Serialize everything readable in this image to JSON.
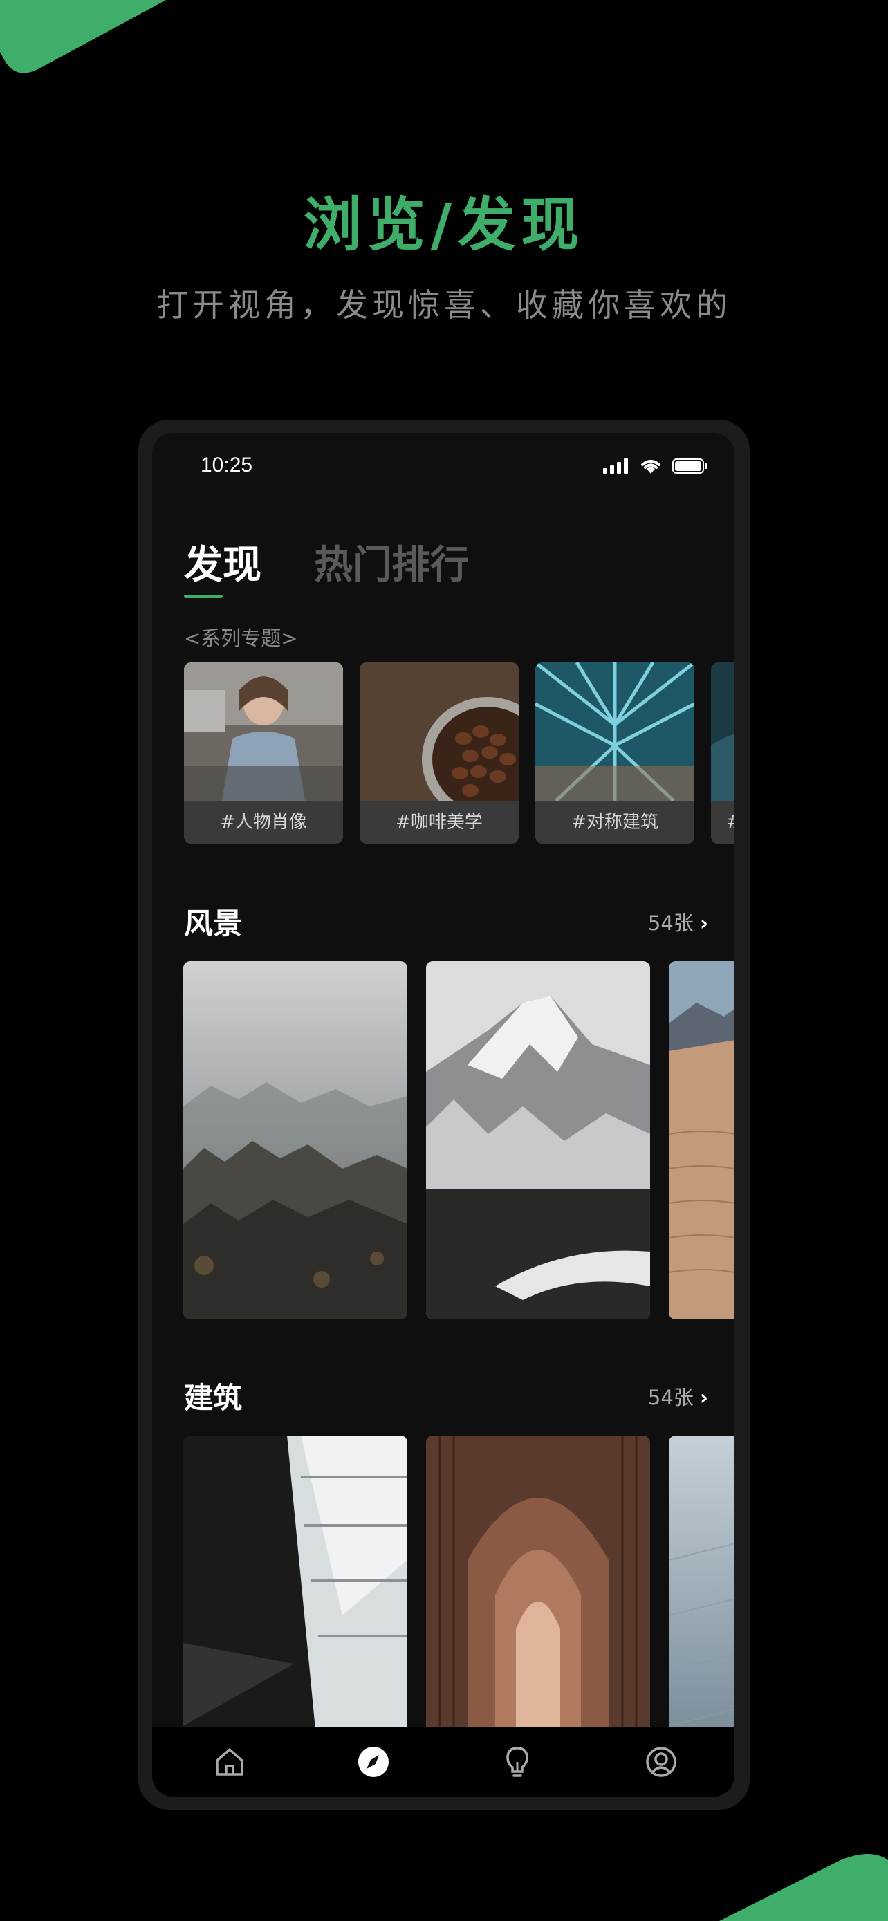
{
  "hero": {
    "title": "浏览/发现",
    "subtitle": "打开视角，发现惊喜、收藏你喜欢的"
  },
  "status_bar": {
    "time": "10:25"
  },
  "tabs": [
    {
      "label": "发现",
      "active": true
    },
    {
      "label": "热门排行",
      "active": false
    }
  ],
  "series": {
    "label": "<系列专题>",
    "items": [
      {
        "caption": "#人物肖像"
      },
      {
        "caption": "#咖啡美学"
      },
      {
        "caption": "#对称建筑"
      },
      {
        "caption": "#"
      }
    ]
  },
  "sections": [
    {
      "title": "风景",
      "count": "54张"
    },
    {
      "title": "建筑",
      "count": "54张"
    }
  ],
  "bottom_nav": [
    {
      "icon": "home-icon"
    },
    {
      "icon": "compass-icon",
      "active": true
    },
    {
      "icon": "lightbulb-icon"
    },
    {
      "icon": "profile-icon"
    }
  ],
  "colors": {
    "accent": "#3fae6a",
    "background": "#000000",
    "screen": "#0f0f0f"
  }
}
